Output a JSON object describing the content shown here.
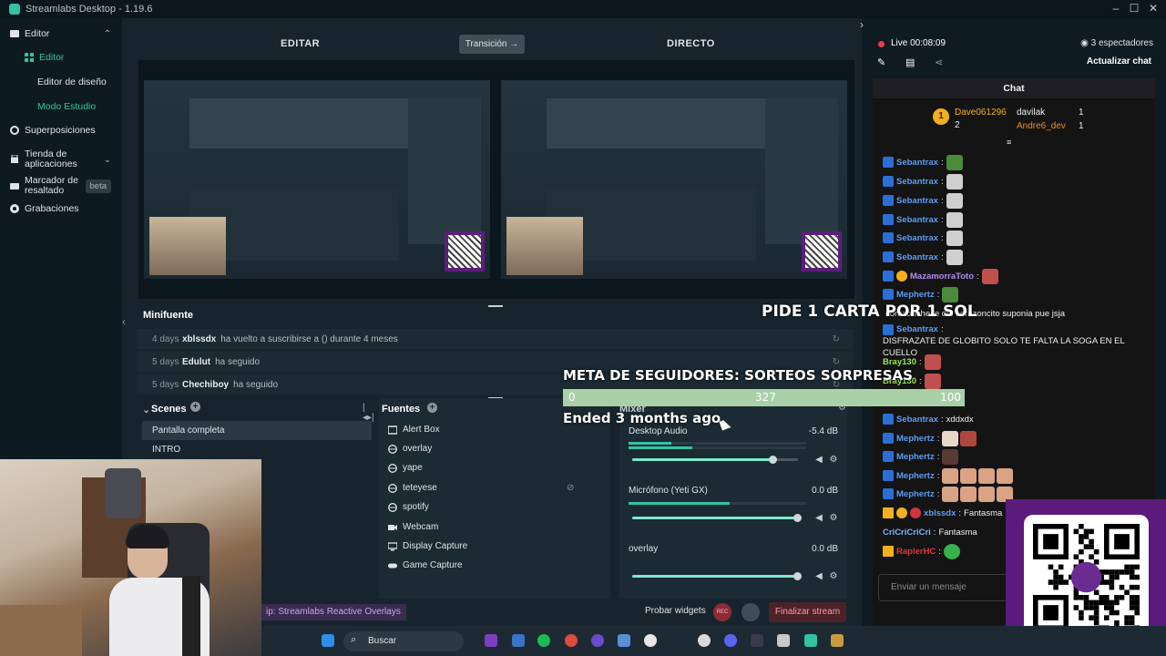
{
  "titlebar": {
    "title": "Streamlabs Desktop - 1.19.6"
  },
  "sidebar": {
    "items": [
      {
        "label": "Editor"
      },
      {
        "label": "Editor"
      },
      {
        "label": "Editor de diseño"
      },
      {
        "label": "Modo Estudio"
      },
      {
        "label": "Superposiciones"
      },
      {
        "label": "Tienda de aplicaciones"
      },
      {
        "label": "Marcador de resaltado",
        "badge": "beta"
      },
      {
        "label": "Grabaciones"
      }
    ]
  },
  "studio": {
    "edit_label": "EDITAR",
    "transition_label": "Transición",
    "live_label": "DIRECTO"
  },
  "minifuente": {
    "title": "Minifuente",
    "rows": [
      {
        "age": "4 days",
        "user": "xblssdx",
        "msg": "ha vuelto a suscribirse a () durante 4 meses"
      },
      {
        "age": "5 days",
        "user": "Edulut",
        "msg": "ha seguido"
      },
      {
        "age": "5 days",
        "user": "Chechiboy",
        "msg": "ha seguido"
      }
    ]
  },
  "scenes": {
    "title": "Scenes",
    "items": [
      "Pantalla completa",
      "INTRO"
    ]
  },
  "sources": {
    "title": "Fuentes",
    "items": [
      "Alert Box",
      "overlay",
      "yape",
      "teteyese",
      "spotify",
      "Webcam",
      "Display Capture",
      "Game Capture"
    ]
  },
  "mixer": {
    "title": "Mixer",
    "channels": [
      {
        "name": "Desktop Audio",
        "db": "-5.4 dB",
        "volume": 0.85
      },
      {
        "name": "Micrófono (Yeti GX)",
        "db": "0.0 dB",
        "volume": 1.0
      },
      {
        "name": "overlay",
        "db": "0.0 dB",
        "volume": 1.0
      }
    ]
  },
  "footer": {
    "tip": "ip: Streamlabs Reactive Overlays",
    "test_widgets": "Probar widgets",
    "rec": "REC",
    "end_stream": "Finalizar stream"
  },
  "right": {
    "live": "Live 00:08:09",
    "viewers": "3 espectadores",
    "refresh_chat": "Actualizar chat",
    "chat_title": "Chat",
    "leaderboard": [
      {
        "name": "Dave061296",
        "count": "2"
      },
      {
        "name": "davilak",
        "count": "1"
      },
      {
        "name": "Andre6_dev",
        "count": "1"
      }
    ],
    "messages": [
      {
        "user": "Sebantrax",
        "text": ""
      },
      {
        "user": "Sebantrax",
        "text": ""
      },
      {
        "user": "Sebantrax",
        "text": ""
      },
      {
        "user": "Sebantrax",
        "text": ""
      },
      {
        "user": "Sebantrax",
        "text": ""
      },
      {
        "user": "Sebantrax",
        "text": ""
      },
      {
        "user": "MazamorraToto",
        "text": ""
      },
      {
        "user": "Mephertz",
        "text": ""
      },
      {
        "user": "",
        "text": "corazonche le dio corazoncito suponia pue jsja"
      },
      {
        "user": "Sebantrax",
        "text": "DISFRAZATE DE GLOBITO SOLO TE FALTA LA SOGA EN EL CUELLO"
      },
      {
        "user": "Bray130",
        "text": ""
      },
      {
        "user": "Bray130",
        "text": ""
      },
      {
        "user": "Sebantrax",
        "text": "xddxdx"
      },
      {
        "user": "Mephertz",
        "text": ""
      },
      {
        "user": "Mephertz",
        "text": ""
      },
      {
        "user": "Mephertz",
        "text": ""
      },
      {
        "user": "Mephertz",
        "text": ""
      },
      {
        "user": "xblssdx",
        "text": "Fantasma"
      },
      {
        "user": "CriCriCriCri",
        "text": "Fantasma"
      },
      {
        "user": "RaplerHC",
        "text": ""
      }
    ],
    "input_placeholder": "Enviar un mensaje"
  },
  "overlay": {
    "pide": "PIDE 1 CARTA POR 1 SOL",
    "meta": "META DE SEGUIDORES: SORTEOS SORPRESAS",
    "goal_min": "0",
    "goal_current": "327",
    "goal_max": "100",
    "ended": "Ended 3 months ago"
  },
  "taskbar": {
    "search": "Buscar"
  },
  "colors": {
    "accent": "#31c3a2",
    "live_red": "#ee3b4b",
    "end_stream": "#ff9aa3",
    "qr_purple": "#5c1b7a"
  }
}
